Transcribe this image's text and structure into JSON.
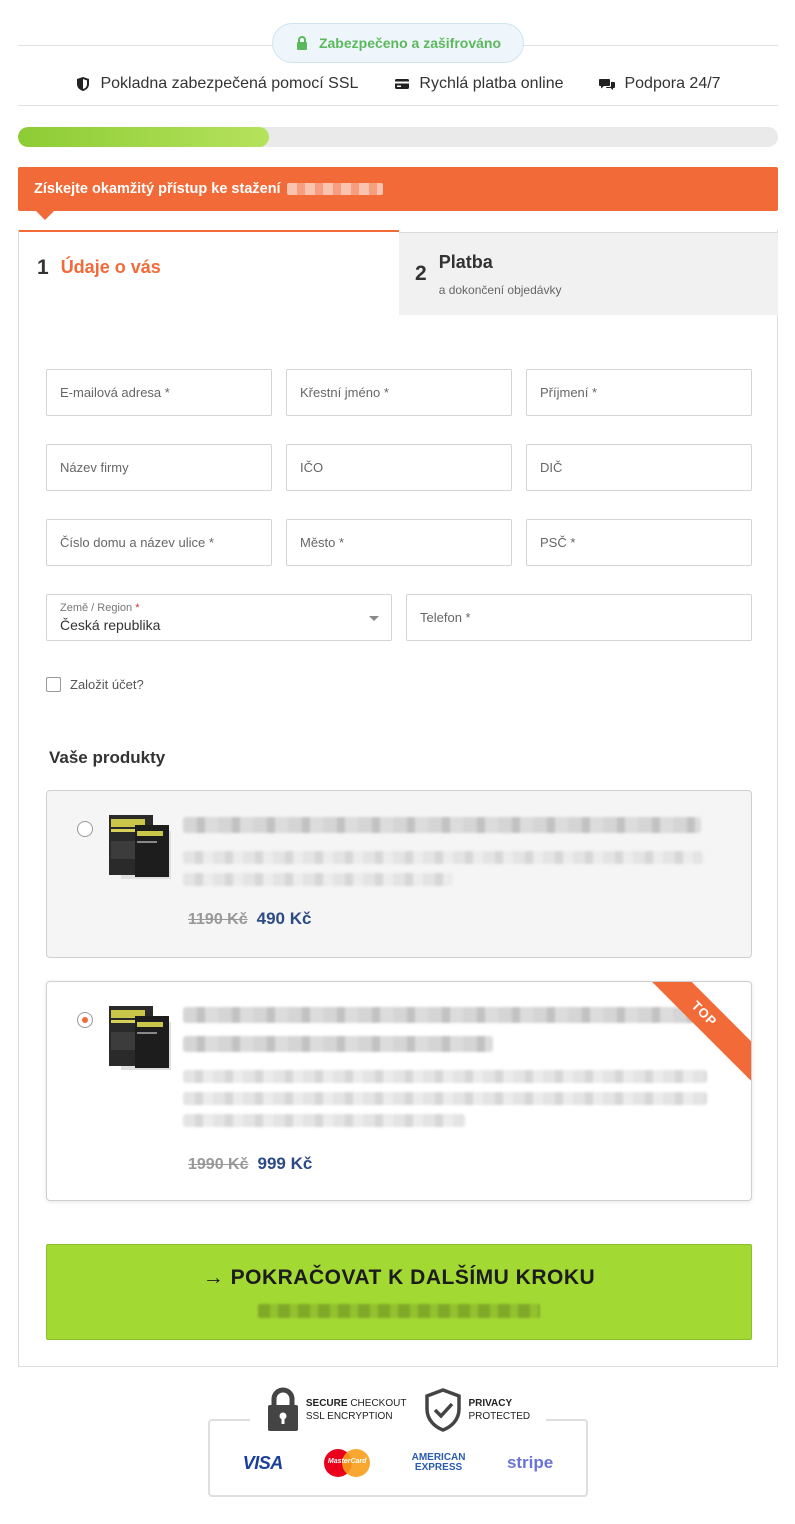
{
  "header": {
    "secure_badge": "Zabezpečeno a zašifrováno",
    "features": [
      {
        "label": "Pokladna zabezpečená pomocí SSL",
        "icon": "shield-icon"
      },
      {
        "label": "Rychlá platba online",
        "icon": "credit-card-icon"
      },
      {
        "label": "Podpora 24/7",
        "icon": "chat-icon"
      }
    ],
    "progress_fraction": 0.33
  },
  "banner": {
    "text": "Získejte okamžitý přístup ke stažení"
  },
  "steps": [
    {
      "number": "1",
      "label": "Údaje o vás"
    },
    {
      "number": "2",
      "label": "Platba",
      "sub": "a dokončení objedávky"
    }
  ],
  "form": {
    "email": "E-mailová adresa *",
    "first_name": "Křestní jméno *",
    "last_name": "Příjmení *",
    "company": "Název firmy",
    "ico": "IČO",
    "dic": "DIČ",
    "street": "Číslo domu a název ulice *",
    "city": "Město *",
    "zip": "PSČ *",
    "country_label": "Země / Region",
    "country_required": "*",
    "country_value": "Česká republika",
    "phone": "Telefon *",
    "create_account": "Založit účet?"
  },
  "products": {
    "title": "Vaše produkty",
    "items": [
      {
        "old_price": "1190 Kč",
        "new_price": "490 Kč",
        "selected": false
      },
      {
        "old_price": "1990 Kč",
        "new_price": "999 Kč",
        "selected": true,
        "ribbon": "TOP"
      }
    ]
  },
  "cta": {
    "label": "→ POKRAČOVAT K DALŠÍMU KROKU"
  },
  "trust": {
    "secure_bold": "SECURE",
    "secure_rest": "CHECKOUT",
    "secure_line2": "SSL ENCRYPTION",
    "privacy_line1": "PRIVACY",
    "privacy_line2": "PROTECTED",
    "cards": {
      "visa": "VISA",
      "mastercard": "MasterCard",
      "amex_1": "AMERICAN",
      "amex_2": "EXPRESS",
      "stripe": "stripe"
    }
  },
  "colors": {
    "accent": "#f26a38",
    "cta_green": "#a3d933",
    "price_blue": "#2c4a85",
    "secure_green": "#5cb85c"
  }
}
